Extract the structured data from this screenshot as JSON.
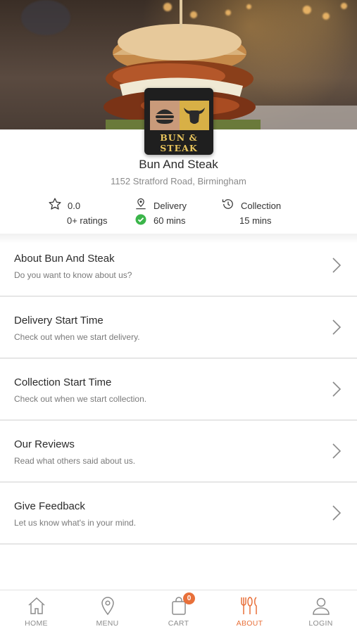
{
  "store": {
    "name": "Bun And Steak",
    "address": "1152 Stratford Road, Birmingham",
    "logo_text": "BUN & STEAK"
  },
  "stats": {
    "rating": {
      "value": "0.0",
      "label": "0+ ratings",
      "icon": "star-icon"
    },
    "delivery": {
      "label": "Delivery",
      "value": "60 mins",
      "icon": "delivery-pin-icon",
      "status_icon": "check-circle-icon"
    },
    "collection": {
      "label": "Collection",
      "value": "15 mins",
      "icon": "clock-history-icon"
    }
  },
  "menu": {
    "items": [
      {
        "title": "About Bun And Steak",
        "subtitle": "Do you want to know about us?"
      },
      {
        "title": "Delivery Start Time",
        "subtitle": "Check out when we start delivery."
      },
      {
        "title": "Collection Start Time",
        "subtitle": "Check out when we start collection."
      },
      {
        "title": "Our Reviews",
        "subtitle": "Read what others said about us."
      },
      {
        "title": "Give Feedback",
        "subtitle": "Let us know what's in your mind."
      }
    ]
  },
  "nav": {
    "items": [
      {
        "label": "HOME",
        "icon": "home-icon",
        "active": false
      },
      {
        "label": "MENU",
        "icon": "location-pin-icon",
        "active": false
      },
      {
        "label": "CART",
        "icon": "shopping-bag-icon",
        "active": false,
        "badge": "0"
      },
      {
        "label": "ABOUT",
        "icon": "cutlery-icon",
        "active": true
      },
      {
        "label": "LOGIN",
        "icon": "user-icon",
        "active": false
      }
    ]
  },
  "colors": {
    "accent": "#e8703a",
    "check_green": "#3bb54a",
    "divider": "#e6e6e6"
  }
}
